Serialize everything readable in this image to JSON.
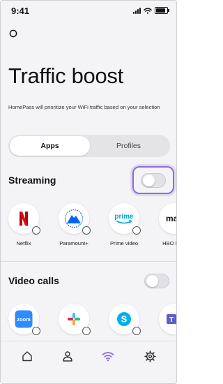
{
  "status_bar": {
    "time": "9:41"
  },
  "page": {
    "title": "Traffic boost",
    "description": "HomePass will prioritize your WiFi traffic based on your selection"
  },
  "tabs": [
    {
      "label": "Apps",
      "active": true
    },
    {
      "label": "Profiles",
      "active": false
    }
  ],
  "sections": [
    {
      "title": "Streaming",
      "toggle_on": false,
      "highlighted": true,
      "apps": [
        {
          "name": "Netflix",
          "icon": "netflix-logo"
        },
        {
          "name": "Paramount+",
          "icon": "paramount-logo"
        },
        {
          "name": "Prime video",
          "icon": "prime-video-logo"
        },
        {
          "name": "HBO Now",
          "icon": "max-logo"
        }
      ]
    },
    {
      "title": "Video calls",
      "toggle_on": false,
      "apps": [
        {
          "name": "",
          "icon": "zoom-logo"
        },
        {
          "name": "",
          "icon": "slack-logo"
        },
        {
          "name": "",
          "icon": "skype-logo"
        },
        {
          "name": "",
          "icon": "teams-logo"
        }
      ]
    }
  ],
  "brand_colors": {
    "accent_purple": "#8b6fd6",
    "netflix_red": "#e50914",
    "paramount_blue": "#0064ff",
    "prime_blue": "#00a8e1",
    "zoom_blue": "#2d8cff",
    "skype_blue": "#00aff0",
    "teams_purple": "#5b5fc7"
  },
  "bottom_nav": [
    {
      "icon": "home-icon",
      "active": false
    },
    {
      "icon": "person-icon",
      "active": false
    },
    {
      "icon": "wifi-icon",
      "active": true
    },
    {
      "icon": "settings-gear-icon",
      "active": false
    }
  ]
}
